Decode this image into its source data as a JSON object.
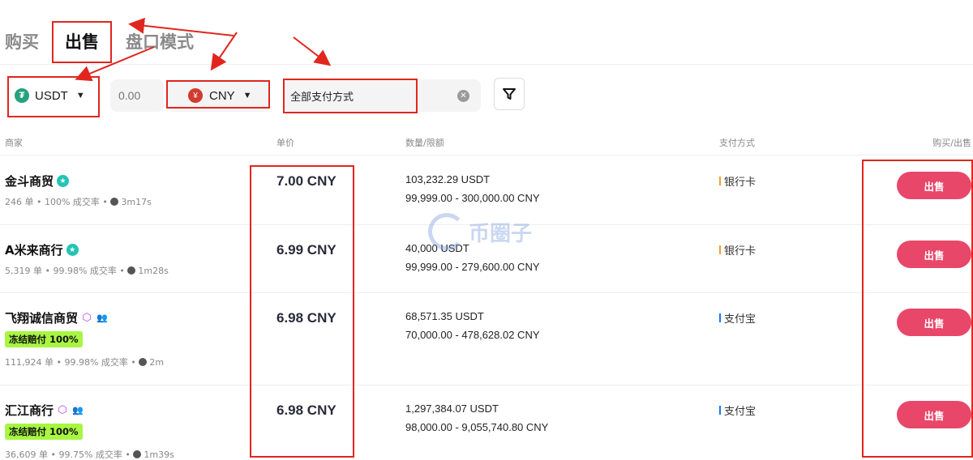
{
  "tabs": {
    "buy": "购买",
    "sell": "出售",
    "orderbook": "盘口模式"
  },
  "filters": {
    "coin": "USDT",
    "amount_placeholder": "0.00",
    "fiat": "CNY",
    "payment": "全部支付方式"
  },
  "table": {
    "headers": {
      "merchant": "商家",
      "price": "单价",
      "quantity": "数量/限额",
      "payment": "支付方式",
      "action": "购买/出售"
    }
  },
  "rows": [
    {
      "name": "金斗商贸",
      "badge": "",
      "orders": "246 单",
      "rate": "100% 成交率",
      "time": "3m17s",
      "price": "7.00 CNY",
      "quantity": "103,232.29 USDT",
      "limit": "99,999.00 - 300,000.00 CNY",
      "payment": "银行卡",
      "pay_color": "#f0a030",
      "action": "出售"
    },
    {
      "name": "A米来商行",
      "badge": "",
      "orders": "5,319 单",
      "rate": "99.98% 成交率",
      "time": "1m28s",
      "price": "6.99 CNY",
      "quantity": "40,000 USDT",
      "limit": "99,999.00 - 279,600.00 CNY",
      "payment": "银行卡",
      "pay_color": "#f0a030",
      "action": "出售"
    },
    {
      "name": "飞翔诚信商贸",
      "badge": "冻结赔付 100%",
      "orders": "111,924 单",
      "rate": "99.98% 成交率",
      "time": "2m",
      "price": "6.98 CNY",
      "quantity": "68,571.35 USDT",
      "limit": "70,000.00 - 478,628.02 CNY",
      "payment": "支付宝",
      "pay_color": "#1677ff",
      "action": "出售"
    },
    {
      "name": "汇江商行",
      "badge": "冻结赔付 100%",
      "orders": "36,609 单",
      "rate": "99.75% 成交率",
      "time": "1m39s",
      "price": "6.98 CNY",
      "quantity": "1,297,384.07 USDT",
      "limit": "98,000.00 - 9,055,740.80 CNY",
      "payment": "支付宝",
      "pay_color": "#1677ff",
      "action": "出售"
    }
  ],
  "watermark": "币圈子"
}
